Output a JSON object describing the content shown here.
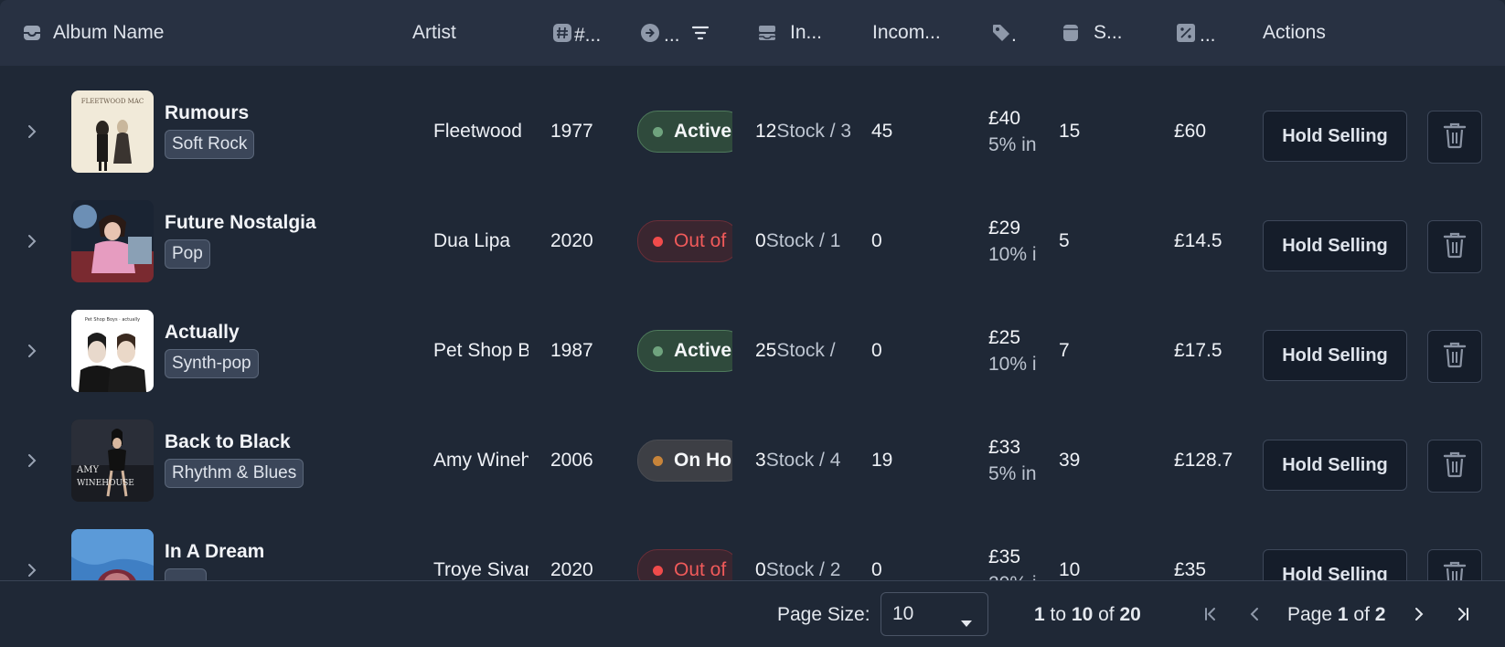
{
  "columns": {
    "album_name": "Album Name",
    "artist": "Artist",
    "year": "#...",
    "status": "...",
    "inventory": "In...",
    "incoming": "Incom...",
    "price": ".",
    "sold": "S...",
    "percent": "...",
    "actions": "Actions"
  },
  "rows": [
    {
      "title": "Rumours",
      "genre": "Soft Rock",
      "artist": "Fleetwood",
      "year": "1977",
      "status": "Active",
      "status_type": "active",
      "stock_num": "12",
      "stock_rest": " Stock / 3",
      "incoming": "45",
      "price": "£40",
      "price_note": "5% in",
      "sold": "15",
      "total": "£60",
      "action": "Hold Selling"
    },
    {
      "title": "Future Nostalgia",
      "genre": "Pop",
      "artist": "Dua Lipa",
      "year": "2020",
      "status": "Out of",
      "status_type": "out",
      "stock_num": "0",
      "stock_rest": " Stock / 1",
      "incoming": "0",
      "price": "£29",
      "price_note": "10% i",
      "sold": "5",
      "total": "£14.5",
      "action": "Hold Selling"
    },
    {
      "title": "Actually",
      "genre": "Synth-pop",
      "artist": "Pet Shop B",
      "year": "1987",
      "status": "Active",
      "status_type": "active",
      "stock_num": "25",
      "stock_rest": " Stock /",
      "incoming": "0",
      "price": "£25",
      "price_note": "10% i",
      "sold": "7",
      "total": "£17.5",
      "action": "Hold Selling"
    },
    {
      "title": "Back to Black",
      "genre": "Rhythm & Blues",
      "artist": "Amy Wineh",
      "year": "2006",
      "status": "On Ho",
      "status_type": "hold",
      "stock_num": "3",
      "stock_rest": " Stock / 4",
      "incoming": "19",
      "price": "£33",
      "price_note": "5% in",
      "sold": "39",
      "total": "£128.7",
      "action": "Hold Selling"
    },
    {
      "title": "In A Dream",
      "genre": "",
      "artist": "Troye Sivar",
      "year": "2020",
      "status": "Out of",
      "status_type": "out",
      "stock_num": "0",
      "stock_rest": " Stock / 2",
      "incoming": "0",
      "price": "£35",
      "price_note": "20% i",
      "sold": "10",
      "total": "£35",
      "action": "Hold Selling"
    }
  ],
  "footer": {
    "page_size_label": "Page Size:",
    "page_size_value": "10",
    "range_from": "1",
    "range_to_word": "to",
    "range_to": "10",
    "range_of_word": "of",
    "range_total": "20",
    "page_word": "Page",
    "page_current": "1",
    "page_of_word": "of",
    "page_total": "2"
  },
  "colors": {
    "background": "#1f2836",
    "header": "#283142",
    "active_dot": "#6fa37e",
    "out_dot": "#f04b4b",
    "hold_dot": "#c7843a"
  }
}
